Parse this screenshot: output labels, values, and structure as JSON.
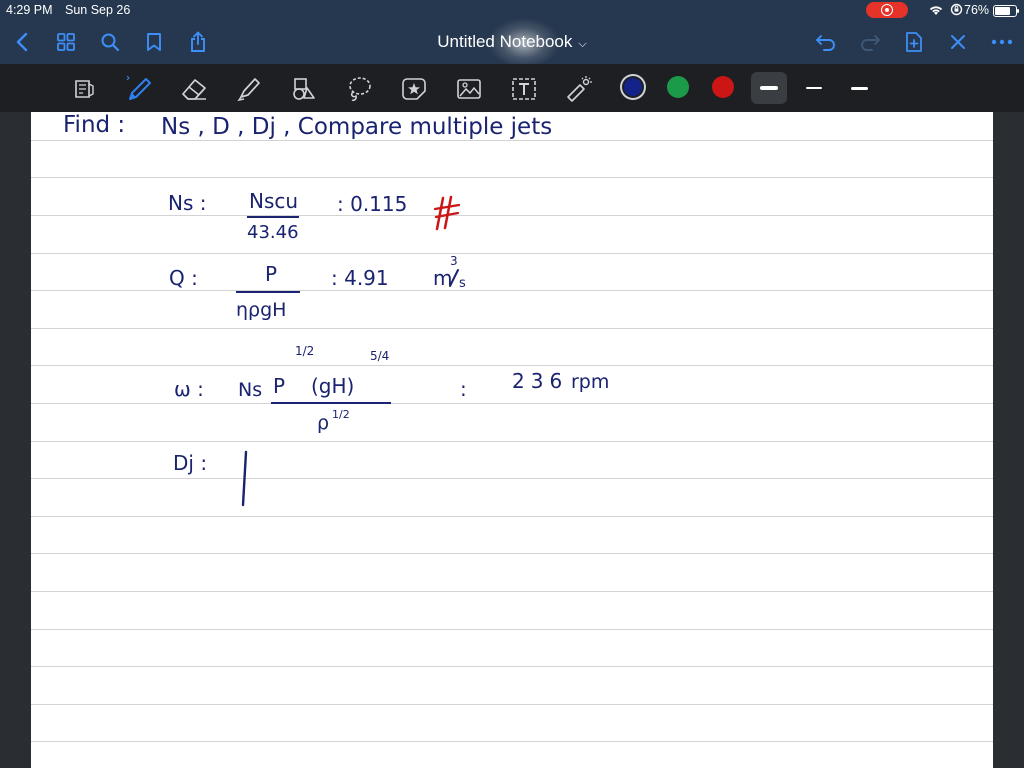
{
  "status": {
    "time": "4:29 PM",
    "date": "Sun Sep 26",
    "battery": "76%"
  },
  "nav": {
    "title": "Untitled Notebook",
    "icons": [
      "back-icon",
      "grid-icon",
      "search-icon",
      "bookmark-icon",
      "share-icon",
      "undo-icon",
      "redo-icon",
      "add-page-icon",
      "close-icon",
      "more-icon"
    ]
  },
  "toolbar": {
    "tools": [
      "reader-icon",
      "pen-icon",
      "eraser-icon",
      "highlighter-icon",
      "shapes-icon",
      "lasso-icon",
      "sticker-icon",
      "image-icon",
      "text-icon",
      "laser-icon"
    ],
    "colors": [
      "#13238a",
      "#1b9a4a",
      "#cc1515"
    ],
    "stroke_widths": [
      "thick",
      "thin",
      "medium"
    ]
  },
  "notes": {
    "find_label": "Find :",
    "find_items": "Ns , D , Dj , Compare multiple jets",
    "ns_lhs": "Ns :",
    "ns_num": "Nscu",
    "ns_den": "43.46",
    "ns_eq": ": 0.115",
    "q_lhs": "Q :",
    "q_num": "P",
    "q_den": "ηρgH",
    "q_eq": ": 4.91",
    "q_unit_base": "m",
    "q_unit_sup": "3",
    "q_unit_den": "s",
    "w_lhs": "ω :",
    "w_ns": "Ns",
    "w_num": "P",
    "w_num_exp": "1/2",
    "w_num_paren": "(gH)",
    "w_num_paren_exp": "5/4",
    "w_den": "ρ",
    "w_den_exp": "1/2",
    "w_eq": ":",
    "w_value": "236",
    "w_unit": "rpm",
    "dj_lhs": "Dj :"
  }
}
